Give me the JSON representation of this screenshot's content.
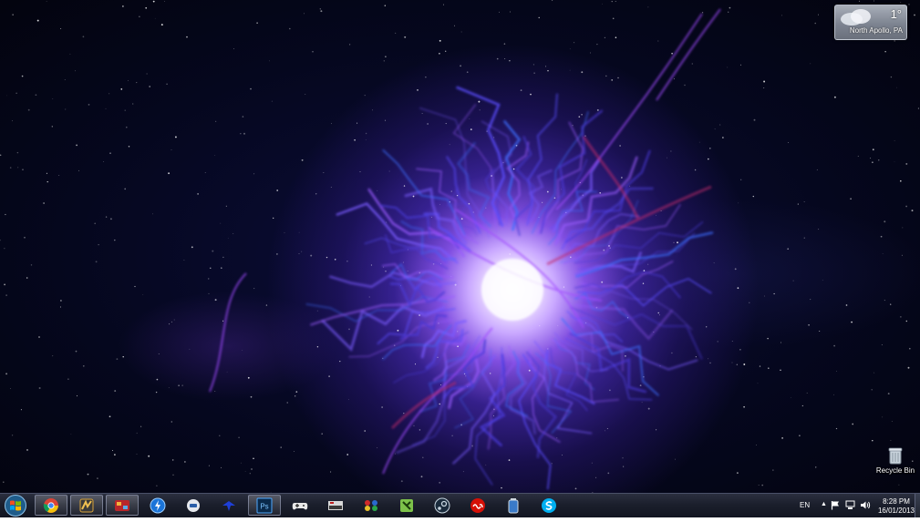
{
  "desktop": {
    "wallpaper_icon": "purple-nebula-orb",
    "colors": {
      "space": "#05071e",
      "orb_core": "#ffffff",
      "orb_glow": "#9a5cff",
      "tendrils": "#5a4dff",
      "accent_red": "#c0285a"
    },
    "recycle_bin": {
      "label": "Recycle Bin",
      "icon": "recycle-bin-icon"
    }
  },
  "weather": {
    "temperature": "1°",
    "location": "North Apollo, PA",
    "icon": "cloud-icon"
  },
  "taskbar": {
    "start_icon": "windows-orb-icon",
    "pinned": [
      {
        "name": "chrome",
        "icon": "chrome-icon",
        "open": true
      },
      {
        "name": "winamp",
        "icon": "winamp-icon",
        "open": true
      },
      {
        "name": "media-app",
        "icon": "media-app-icon",
        "open": true
      },
      {
        "name": "downloader",
        "icon": "lightning-icon",
        "open": false
      },
      {
        "name": "messenger",
        "icon": "robot-icon",
        "open": false
      },
      {
        "name": "bird-app",
        "icon": "bird-icon",
        "open": false
      },
      {
        "name": "photoshop",
        "icon": "photoshop-icon",
        "label": "Ps",
        "open": true
      },
      {
        "name": "gamepad",
        "icon": "gamepad-icon",
        "open": false
      },
      {
        "name": "nes-emulator",
        "icon": "nes-icon",
        "open": false
      },
      {
        "name": "snes-emulator",
        "icon": "snes-icon",
        "open": false
      },
      {
        "name": "notepad-plus",
        "icon": "notepad-plus-icon",
        "open": false
      },
      {
        "name": "steam",
        "icon": "steam-icon",
        "open": false
      },
      {
        "name": "lastfm",
        "icon": "lastfm-icon",
        "open": false
      },
      {
        "name": "battery-app",
        "icon": "battery-icon",
        "open": false
      },
      {
        "name": "skype",
        "icon": "skype-icon",
        "open": false
      }
    ],
    "tray": {
      "language": "EN",
      "chevron": "▲",
      "flag_icon": "action-center-flag-icon",
      "network_icon": "network-icon",
      "volume_icon": "volume-icon",
      "time": "8:28 PM",
      "date": "16/01/2013"
    }
  }
}
